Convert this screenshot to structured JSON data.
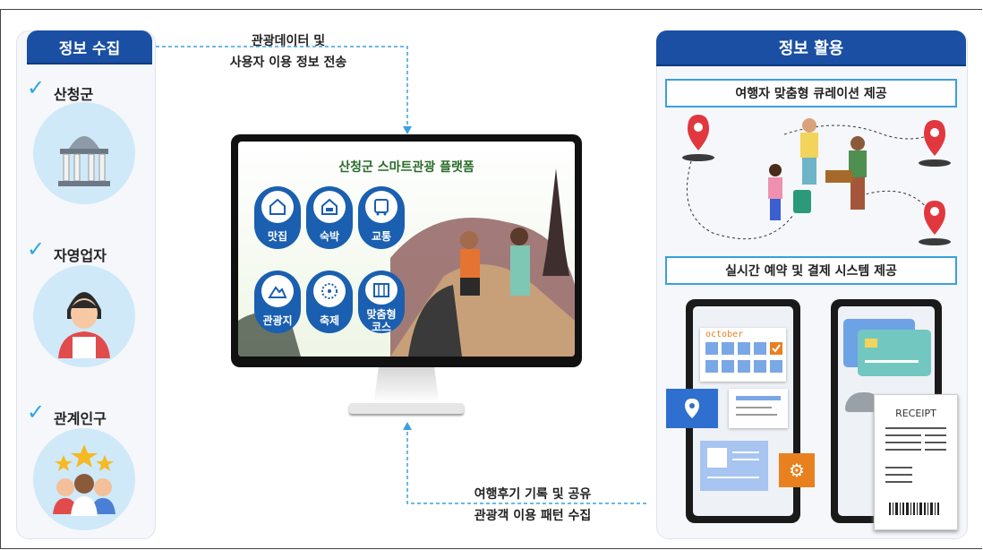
{
  "left_panel": {
    "header": "정보 수집",
    "items": [
      {
        "label": "산청군",
        "icon": "government-building-icon"
      },
      {
        "label": "자영업자",
        "icon": "shop-owner-icon"
      },
      {
        "label": "관계인구",
        "icon": "people-stars-icon"
      }
    ]
  },
  "top_arrow": {
    "line1": "관광데이터 및",
    "line2": "사용자 이용 정보 전송"
  },
  "bottom_arrow": {
    "line1": "여행후기 기록 및 공유",
    "line2": "관광객 이용 패턴 수집"
  },
  "monitor": {
    "title": "산청군 스마트관광 플랫폼",
    "categories": [
      {
        "label": "맛집",
        "icon": "restaurant-icon"
      },
      {
        "label": "숙박",
        "icon": "bed-icon"
      },
      {
        "label": "교통",
        "icon": "bus-icon"
      },
      {
        "label": "관광지",
        "icon": "mountain-icon"
      },
      {
        "label": "축제",
        "icon": "firework-icon"
      },
      {
        "label": "맞춤형 코스",
        "icon": "map-icon"
      }
    ]
  },
  "right_panel": {
    "header": "정보 활용",
    "box1": "여행자 맞춤형 큐레이션 제공",
    "box2": "실시간 예약 및 결제 시스템 제공",
    "calendar_month": "october",
    "receipt_title": "RECEIPT"
  },
  "colors": {
    "primary": "#1a4fa3",
    "accent": "#29a8e0",
    "pin": "#e0383e",
    "orange": "#e8801f"
  }
}
